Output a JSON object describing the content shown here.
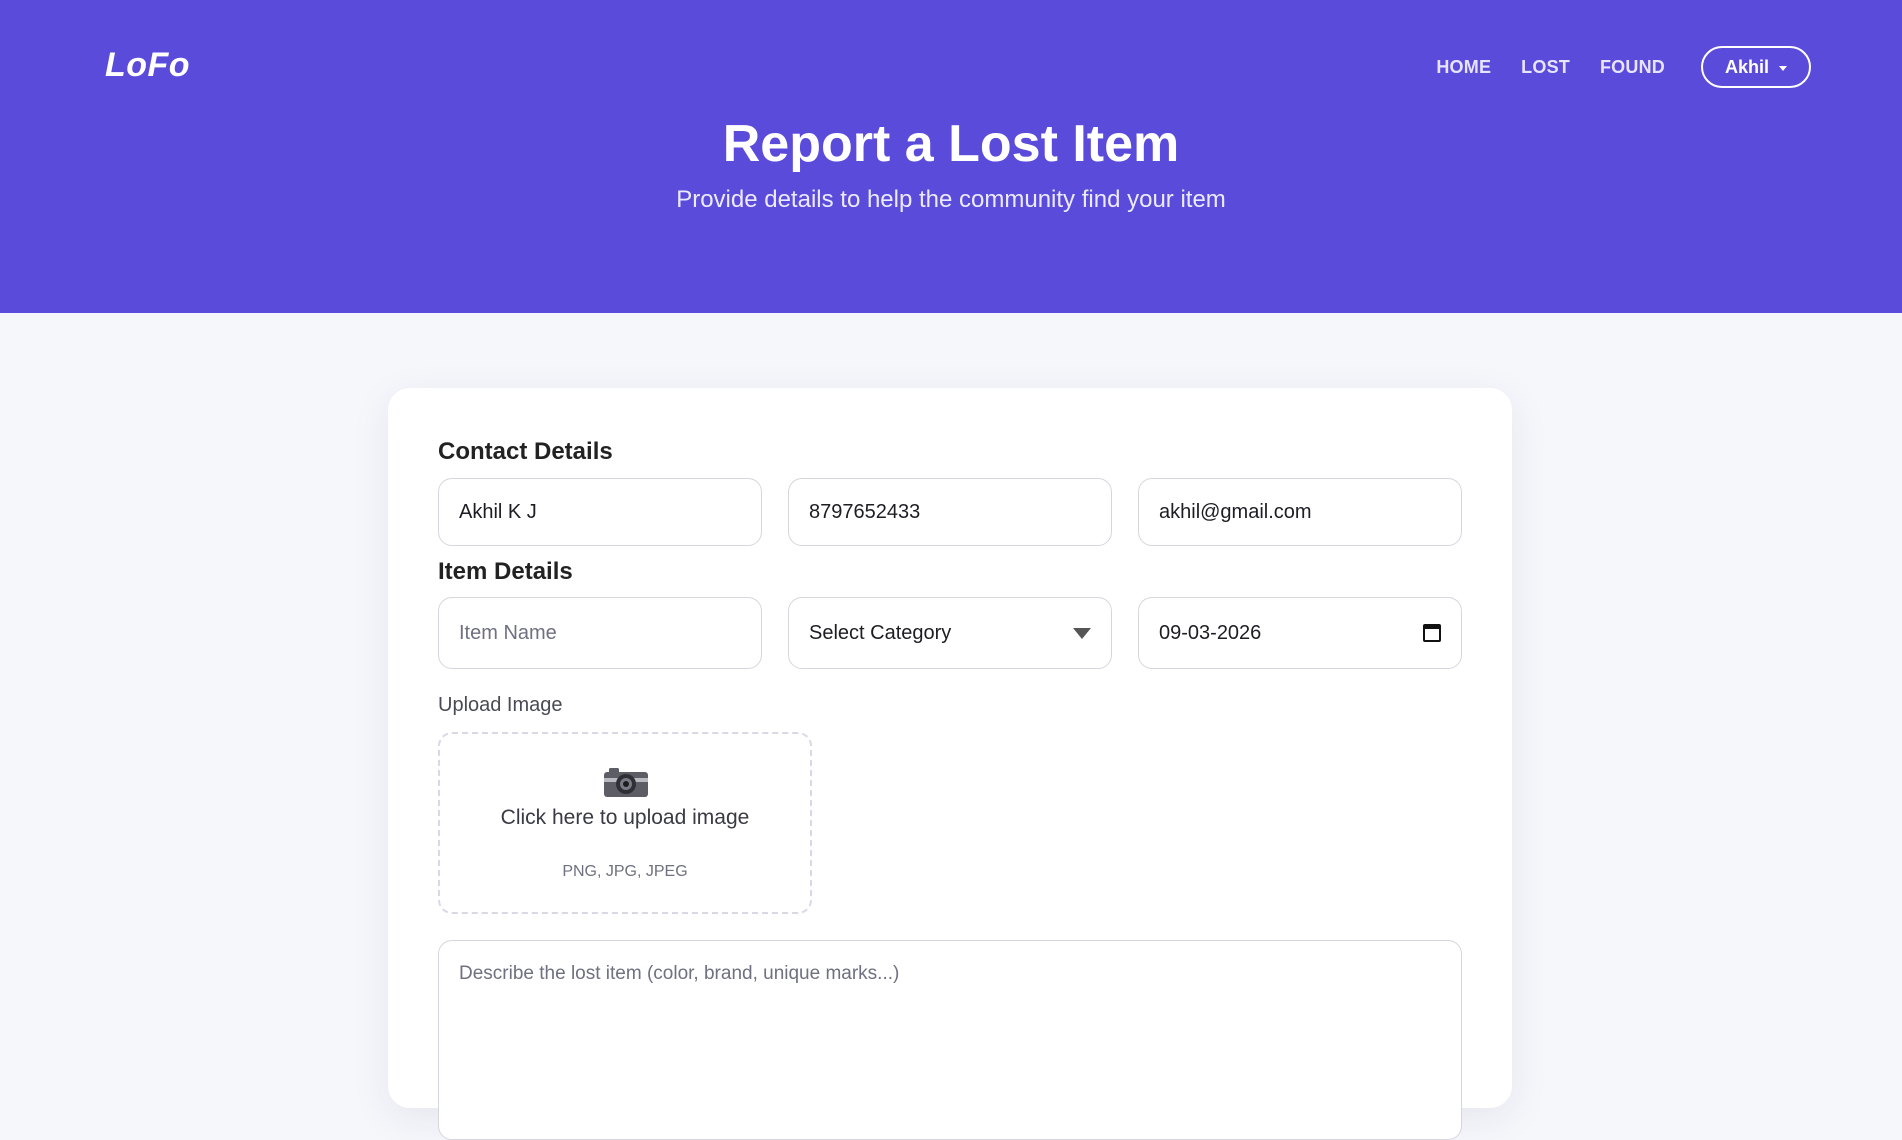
{
  "brand": "LoFo",
  "nav": {
    "home": "HOME",
    "lost": "LOST",
    "found": "FOUND",
    "user": "Akhil"
  },
  "hero": {
    "title": "Report a Lost Item",
    "subtitle": "Provide details to help the community find your item"
  },
  "contact": {
    "title": "Contact Details",
    "name": "Akhil K J",
    "phone": "8797652433",
    "email": "akhil@gmail.com"
  },
  "item": {
    "title": "Item Details",
    "name_placeholder": "Item Name",
    "category": "Select Category",
    "date": "09-03-2026"
  },
  "upload": {
    "label": "Upload Image",
    "cta": "Click here to upload image",
    "hint": "PNG, JPG, JPEG",
    "icon": "camera-icon"
  },
  "description": {
    "placeholder": "Describe the lost item (color, brand, unique marks...)"
  },
  "colors": {
    "hero_bg": "#5b4bdb",
    "page_bg": "#f6f7fb",
    "card_bg": "#ffffff"
  }
}
